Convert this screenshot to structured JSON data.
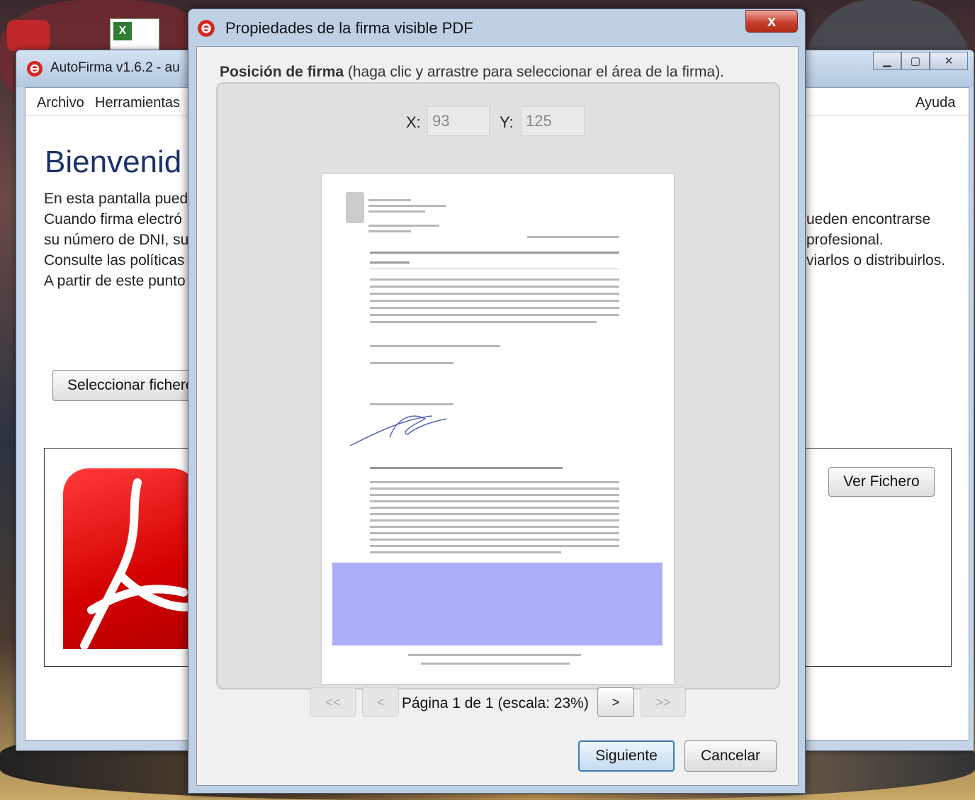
{
  "main_window": {
    "title": "AutoFirma v1.6.2 - au",
    "menu": {
      "archivo": "Archivo",
      "herramientas": "Herramientas",
      "ayuda": "Ayuda"
    },
    "welcome": "Bienvenid",
    "paragraph_left": [
      "En esta pantalla pued",
      "Cuando firma electró",
      "su número de DNI, su",
      "Consulte las políticas",
      "A partir de este punto"
    ],
    "paragraph_right": [
      "ueden encontrarse",
      "profesional.",
      "viarlos o distribuirlos."
    ],
    "select_file_button": "Seleccionar fichero",
    "view_file_button": "Ver Fichero"
  },
  "dialog": {
    "title": "Propiedades de la firma visible PDF",
    "close_label": "x",
    "position_bold": "Posición de firma",
    "position_rest": " (haga clic y arrastre para seleccionar el área de la firma).",
    "x_label": "X:",
    "x_value": "93",
    "y_label": "Y:",
    "y_value": "125",
    "nav": {
      "first": "<<",
      "prev": "<",
      "next": ">",
      "last": ">>"
    },
    "page_label": "Página 1 de 1 (escala: 23%)",
    "next_button": "Siguiente",
    "cancel_button": "Cancelar"
  },
  "colors": {
    "signature_area": "#adadf7",
    "welcome_text": "#1b3168",
    "close_button": "#c8412f"
  }
}
